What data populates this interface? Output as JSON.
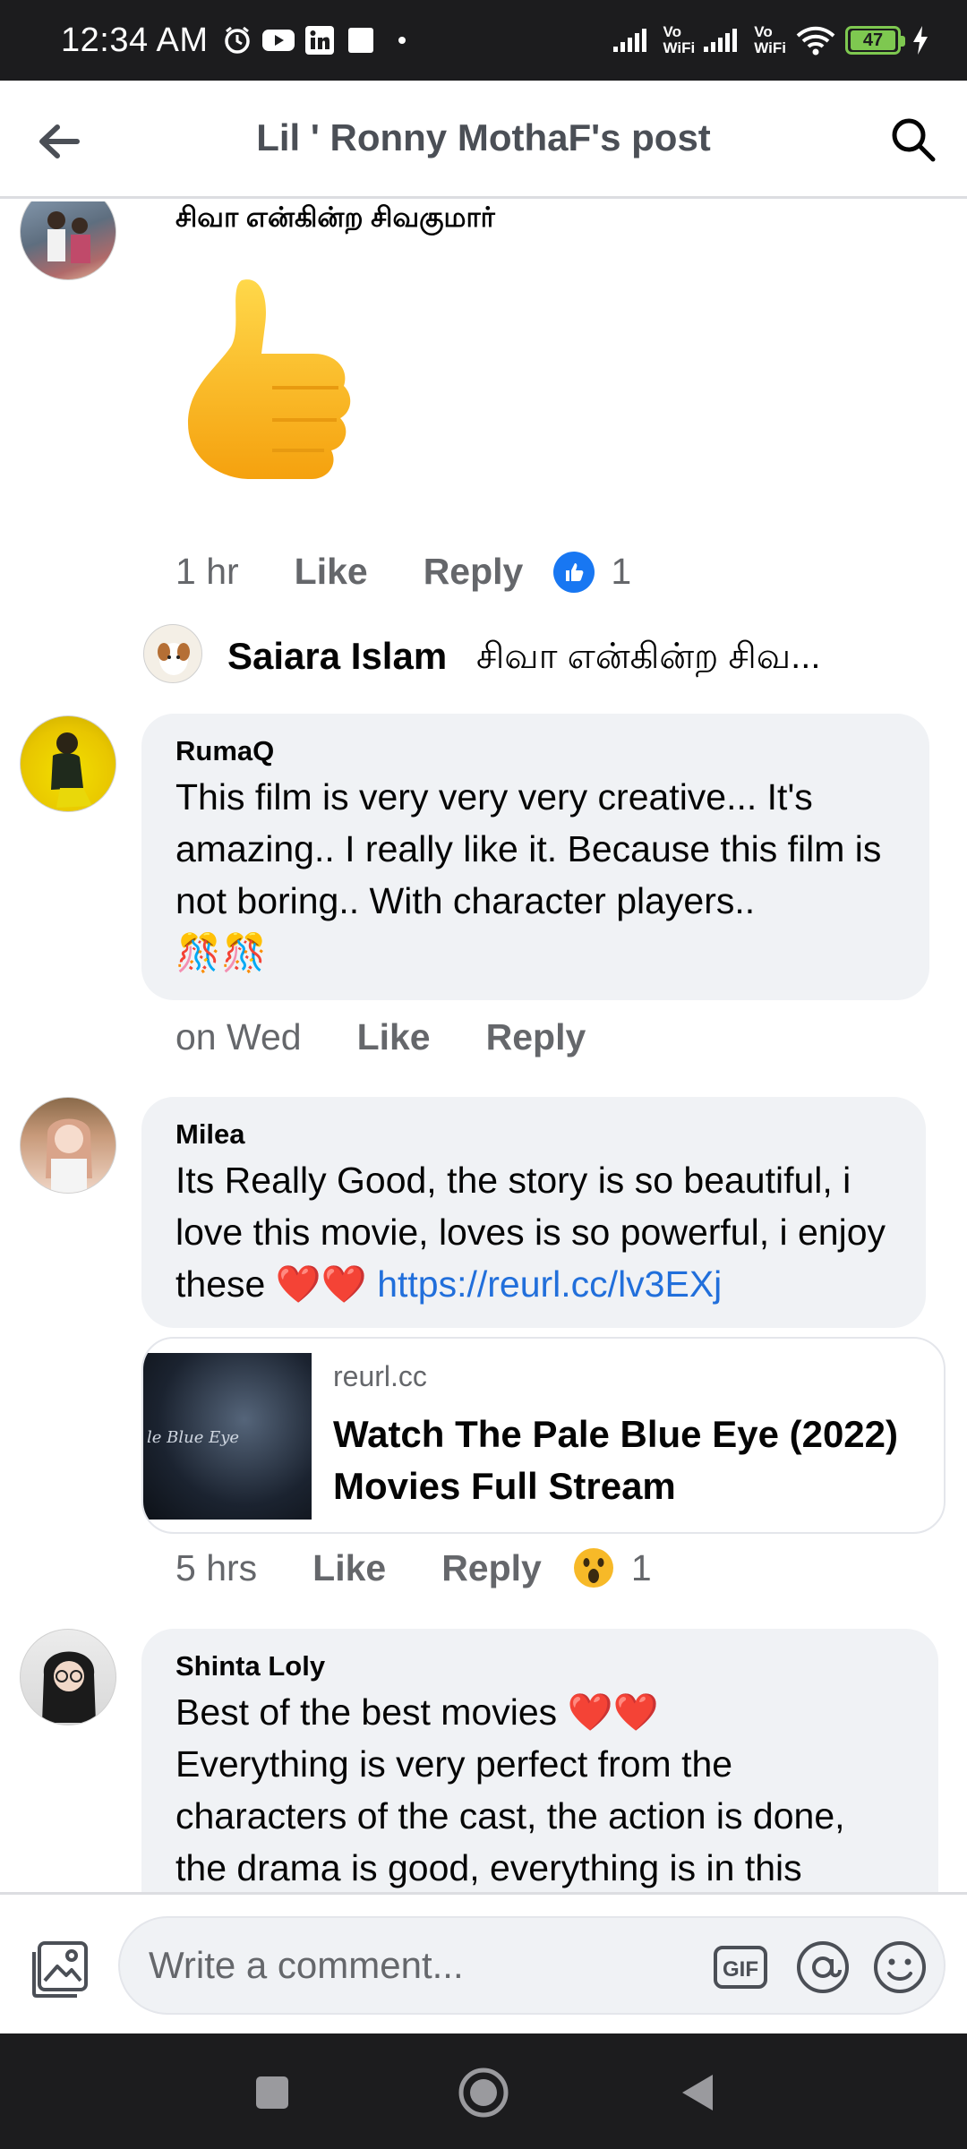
{
  "status_bar": {
    "time": "12:34 AM",
    "volte1": "Vo\nWiFi",
    "volte2": "Vo\nWiFi",
    "battery": "47",
    "icons": [
      "alarm-icon",
      "youtube-icon",
      "linkedin-icon",
      "notification-icon",
      "dot-icon",
      "signal-icon",
      "wifi-icon",
      "battery-icon",
      "charging-icon"
    ]
  },
  "header": {
    "title": "Lil ' Ronny MothaF's post"
  },
  "comments": [
    {
      "author": "சிவா என்கின்ற சிவகுமார்",
      "sticker": "thumbs-up-sticker",
      "time": "1 hr",
      "like": "Like",
      "reply": "Reply",
      "reaction": "like",
      "reaction_count": "1",
      "reply_preview": {
        "author": "Saiara Islam",
        "text": "சிவா என்கின்ற சிவ..."
      }
    },
    {
      "author": "RumaQ",
      "text": "This film is very very very creative... It's amazing.. I really like it. Because this film is not boring.. With character players..",
      "emoji": "🎊🎊",
      "time": "on Wed",
      "like": "Like",
      "reply": "Reply"
    },
    {
      "author": "Milea",
      "text": "Its Really Good, the story is so beautiful, i love this movie, loves is so powerful, i enjoy these ❤️❤️",
      "link": "https://reurl.cc/lv3EXj",
      "link_preview": {
        "domain": "reurl.cc",
        "title": "Watch The Pale Blue Eye (2022) Movies Full Stream",
        "thumb_text": "le Blue Eye"
      },
      "time": "5 hrs",
      "like": "Like",
      "reply": "Reply",
      "reaction": "wow",
      "reaction_count": "1"
    },
    {
      "author": "Shinta Loly",
      "line1": "Best of the best movies ❤️❤️",
      "text": "Everything is very perfect from the characters of the cast, the action is done, the drama is good, everything is in this"
    }
  ],
  "composer": {
    "placeholder": "Write a comment...",
    "gif_label": "GIF"
  },
  "colors": {
    "bubble": "#f0f2f5",
    "link": "#216fdb",
    "like_blue": "#1877f2",
    "meta": "#65676b"
  }
}
